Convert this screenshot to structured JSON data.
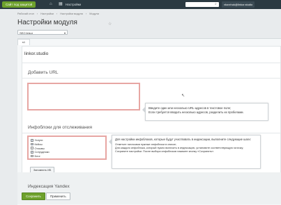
{
  "topbar": {
    "site_button": "Сайт под защитой",
    "settings_label": "Настройки",
    "user": "vkorzhuk@linkor.studio"
  },
  "breadcrumbs": [
    "Рабочий стол",
    "Настройки",
    "Настройки модуля",
    "Модули"
  ],
  "page_title": "Настройки модуля",
  "site_select": "SEO linkor",
  "tab_label": "s1",
  "brand": "linkor.studio",
  "add_url": {
    "title": "Добавить URL",
    "tooltip_line1": "Введите один или несколько URL-адресов в текстовое поле;",
    "tooltip_line2": "Если требуется вводить несколько адресов, разделить их пробелами."
  },
  "infoblocks": {
    "title": "Инфоблоки для отслеживания",
    "items": [
      {
        "label": "Услуги",
        "checked": true
      },
      {
        "label": "Кейсы",
        "checked": true
      },
      {
        "label": "Отзывы",
        "checked": false
      },
      {
        "label": "Сотрудники",
        "checked": true
      },
      {
        "label": "Блог",
        "checked": false
      }
    ],
    "remember_button": "Запомнить ИБ",
    "tip_lead": "Для настройки инфоблоков, которые будут участвовать в индексации, выполните следующие шаги:",
    "tip_steps": [
      "Отметьте галочками нужные инфоблоки в списке;",
      "Для каждого инфоблока, который нужно включить в индексацию, установите соответствующую галочку;",
      "Сохраните настройки. После выбора инфоблоков нажмите кнопку «Сохранить»."
    ]
  },
  "yandex_section": "Индексация Yandex",
  "footer": {
    "save": "Сохранить",
    "apply": "Применить"
  },
  "colors": {
    "accent_green": "#6ea12c",
    "error_border": "#e7a6a3",
    "topbar": "#2b3a42"
  }
}
